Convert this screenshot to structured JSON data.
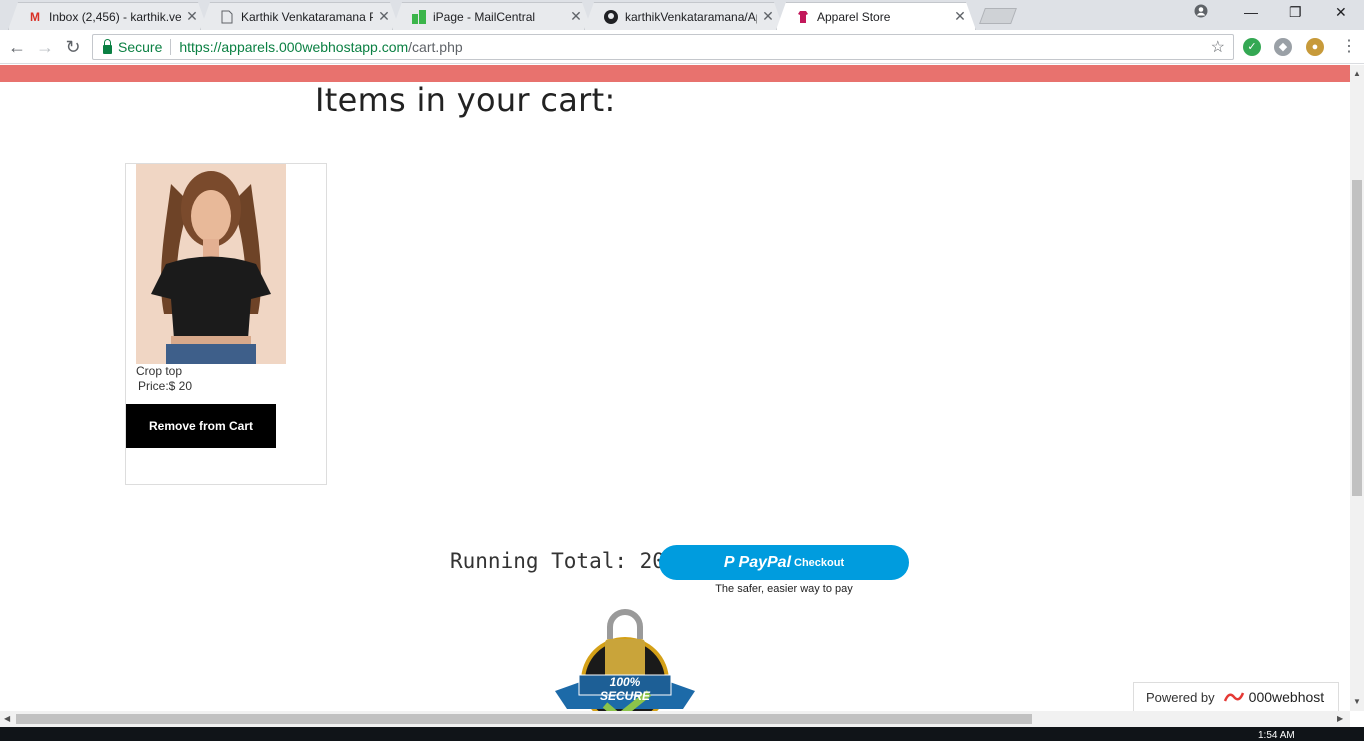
{
  "browser": {
    "tabs": [
      {
        "title": "Inbox (2,456) - karthik.ven",
        "icon": "gmail-icon",
        "active": false
      },
      {
        "title": "Karthik Venkataramana P",
        "icon": "document-icon",
        "active": false
      },
      {
        "title": "iPage - MailCentral",
        "icon": "ipage-icon",
        "active": false
      },
      {
        "title": "karthikVenkataramana/Ap",
        "icon": "github-icon",
        "active": false
      },
      {
        "title": "Apparel Store",
        "icon": "apparel-icon",
        "active": true
      }
    ],
    "secure_label": "Secure",
    "url_host": "https://apparels.000webhostapp.com",
    "url_path": "/cart.php"
  },
  "page": {
    "heading": "Items in your cart:",
    "cart_items": [
      {
        "name": "Crop top",
        "price": "Price:$ 20",
        "remove_label": "Remove from Cart"
      }
    ],
    "running_total": "Running Total: 20$",
    "paypal": {
      "brand": "PayPal",
      "action": "Checkout",
      "tagline": "The safer, easier way to pay"
    },
    "secure_badge": "100% SECURE",
    "powered_by": {
      "label": "Powered by",
      "brand": "000webhost"
    }
  },
  "taskbar": {
    "clock": "1:54 AM"
  },
  "colors": {
    "accent_bar": "#e8726e",
    "paypal_blue": "#009cde",
    "secure_green": "#0b8043"
  }
}
